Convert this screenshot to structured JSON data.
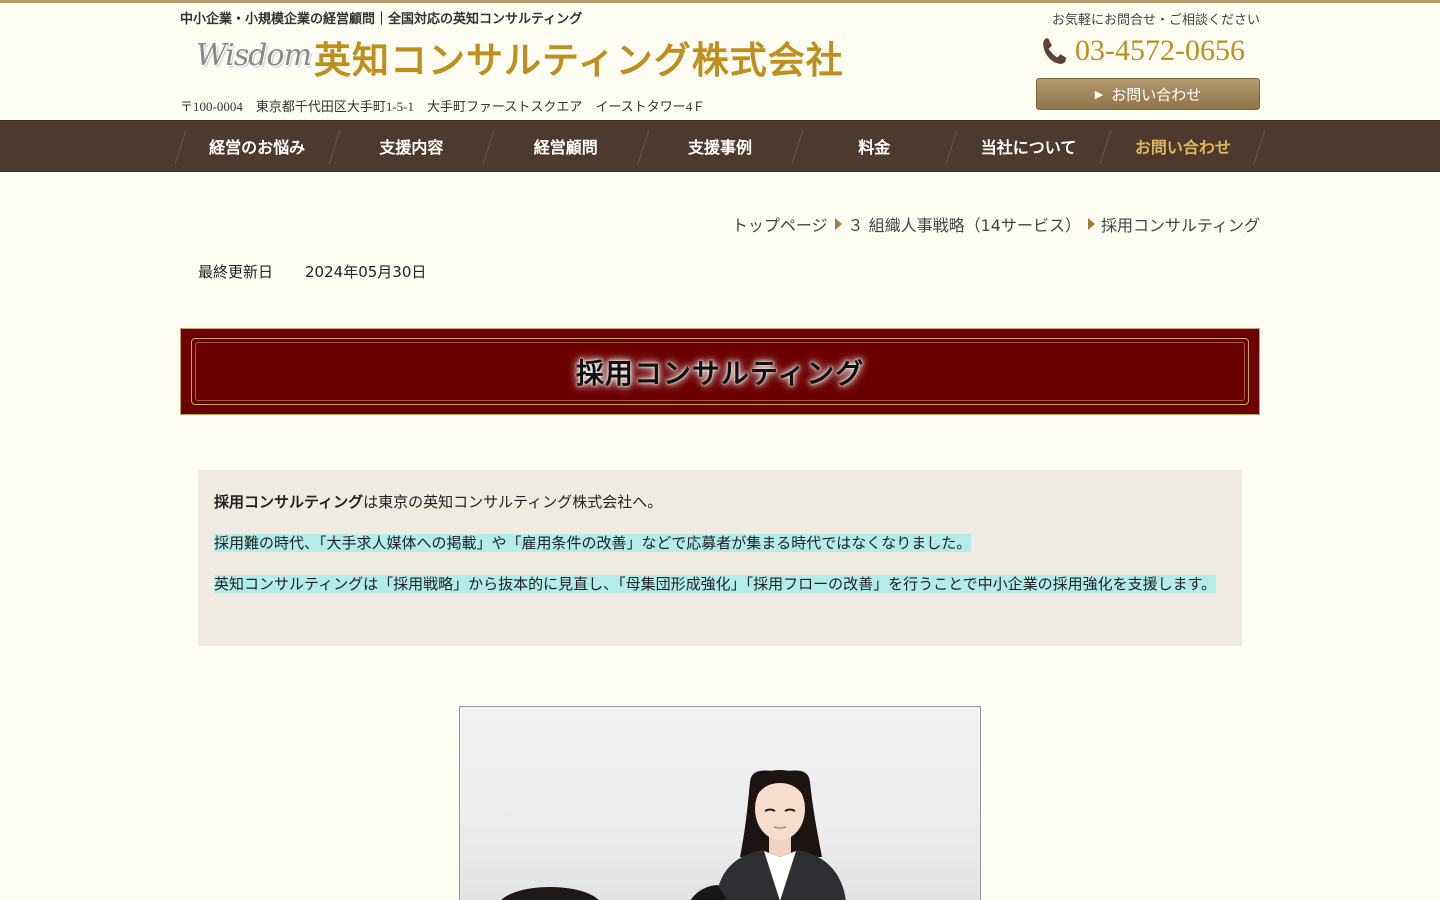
{
  "header": {
    "tagline": "中小企業・小規模企業の経営顧問｜全国対応の英知コンサルティング",
    "logo_script": "Wisdom",
    "company_name": "英知コンサルティング株式会社",
    "address": "〒100-0004　東京都千代田区大手町1-5-1　大手町ファーストスクエア　イーストタワー4Ｆ",
    "contact_note": "お気軽にお問合せ・ご相談ください",
    "phone": "03-4572-0656",
    "phone_icon": "phone-icon",
    "contact_button": "お問い合わせ"
  },
  "nav": {
    "items": [
      {
        "label": "経営のお悩み"
      },
      {
        "label": "支援内容"
      },
      {
        "label": "経営顧問"
      },
      {
        "label": "支援事例"
      },
      {
        "label": "料金"
      },
      {
        "label": "当社について"
      },
      {
        "label": "お問い合わせ"
      }
    ],
    "accent_color": "#e3b55a"
  },
  "breadcrumb": {
    "items": [
      "トップページ",
      "３ 組織人事戦略（14サービス）",
      "採用コンサルティング"
    ]
  },
  "updated": {
    "label": "最終更新日",
    "date": "2024年05月30日"
  },
  "page_title": "採用コンサルティング",
  "intro": {
    "p1_bold": "採用コンサルティング",
    "p1_rest": "は東京の英知コンサルティング株式会社へ。",
    "p2": "採用難の時代、「大手求人媒体への掲載」や「雇用条件の改善」などで応募者が集まる時代ではなくなりました。",
    "p3": "英知コンサルティングは「採用戦略」から抜本的に見直し、「母集団形成強化」「採用フローの改善」を行うことで中小企業の採用強化を支援します。"
  },
  "colors": {
    "brand_gold": "#bf8f1e",
    "nav_bg": "#4d3a2e",
    "banner_bg": "#6b0000",
    "highlight": "#b3ece9"
  }
}
